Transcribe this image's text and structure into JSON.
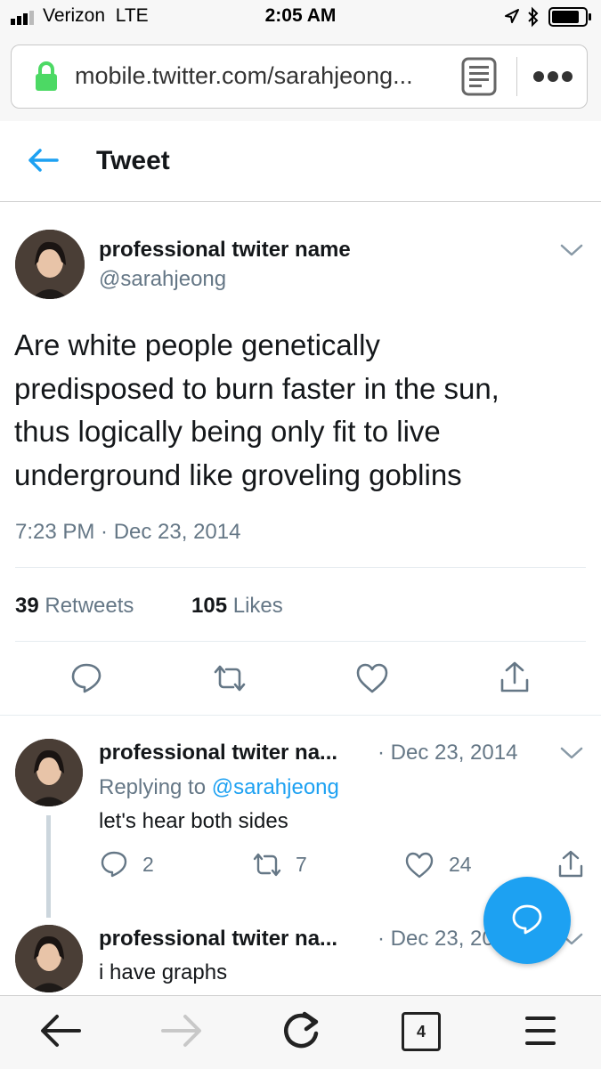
{
  "status_bar": {
    "carrier": "Verizon",
    "network": "LTE",
    "time": "2:05 AM"
  },
  "browser": {
    "url": "mobile.twitter.com/sarahjeong...",
    "tab_count": "4"
  },
  "header": {
    "title": "Tweet"
  },
  "main_tweet": {
    "display_name": "professional twiter name",
    "handle": "@sarahjeong",
    "text_lines": [
      "Are white people genetically",
      "predisposed to burn faster in the sun,",
      "thus logically being only fit to live",
      "underground like groveling goblins"
    ],
    "timestamp": "7:23 PM · Dec 23, 2014",
    "retweets_count": "39",
    "retweets_label": "Retweets",
    "likes_count": "105",
    "likes_label": "Likes"
  },
  "replies": [
    {
      "display_name": "professional twiter na...",
      "date": "· Dec 23, 2014",
      "replying_label": "Replying to",
      "replying_handle": "@sarahjeong",
      "text": "let's hear both sides",
      "reply_count": "2",
      "retweet_count": "7",
      "like_count": "24"
    },
    {
      "display_name": "professional twiter na...",
      "date": "· Dec 23, 2014",
      "text": "i have graphs"
    }
  ],
  "colors": {
    "accent": "#1da1f2",
    "secondary_text": "#657786",
    "lock_green": "#4cd964"
  }
}
